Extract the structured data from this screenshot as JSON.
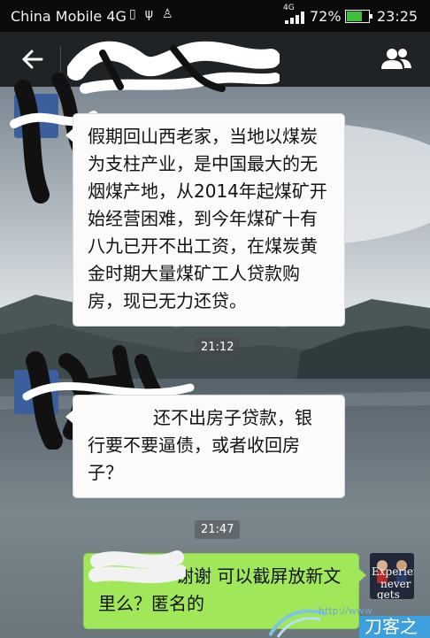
{
  "status_bar": {
    "carrier": "China Mobile 4G",
    "network_badge": "4G",
    "battery_percent": "72%",
    "battery_level": 0.72,
    "time": "23:25",
    "icons": [
      "sim-icon",
      "usb-icon",
      "android-icon",
      "signal-icon",
      "battery-icon"
    ]
  },
  "header": {
    "back_icon": "back-arrow-icon",
    "contacts_icon": "chat-members-icon",
    "title": ""
  },
  "messages": [
    {
      "side": "received",
      "text": "假期回山西老家，当地以煤炭为支柱产业，是中国最大的无烟煤产地，从2014年起煤矿开始经营困难，到今年煤矿十有八九已开不出工资，在煤炭黄金时期大量煤矿工人贷款购房，现已无力还贷。",
      "lines": [
        "假期回山西老家，当地以煤炭",
        "为支柱产业，是中国最大的无",
        "烟煤产地，从2014年起煤矿开",
        "始经营困难，到今年煤矿十有",
        "八九已开不出工资，在煤炭黄",
        "金时期大量煤矿工人贷款购",
        "房，现已无力还贷。"
      ]
    },
    {
      "side": "time",
      "text": "21:12"
    },
    {
      "side": "received",
      "text": "还不出房子贷款，银行要不要逼债，或者收回房子？",
      "lines": [
        "还不出房子贷款，银",
        "行要不要逼债，或者收回房",
        "子？"
      ]
    },
    {
      "side": "time",
      "text": "21:47"
    },
    {
      "side": "sent",
      "text": "谢谢 可以截屏放新文里么？匿名的",
      "lines": [
        "谢谢 可以截屏放新文",
        "里么？匿名的"
      ]
    }
  ],
  "avatar_overlay_text": [
    "Experience",
    "never",
    "gets old."
  ],
  "watermark": {
    "url": "http://www",
    "brand": "刀客之家"
  },
  "colors": {
    "sent_bubble": "#a0e75a",
    "received_bubble": "#fbfbfb",
    "title_bar": "#1f2326",
    "battery_fill": "#3fbf3f"
  }
}
